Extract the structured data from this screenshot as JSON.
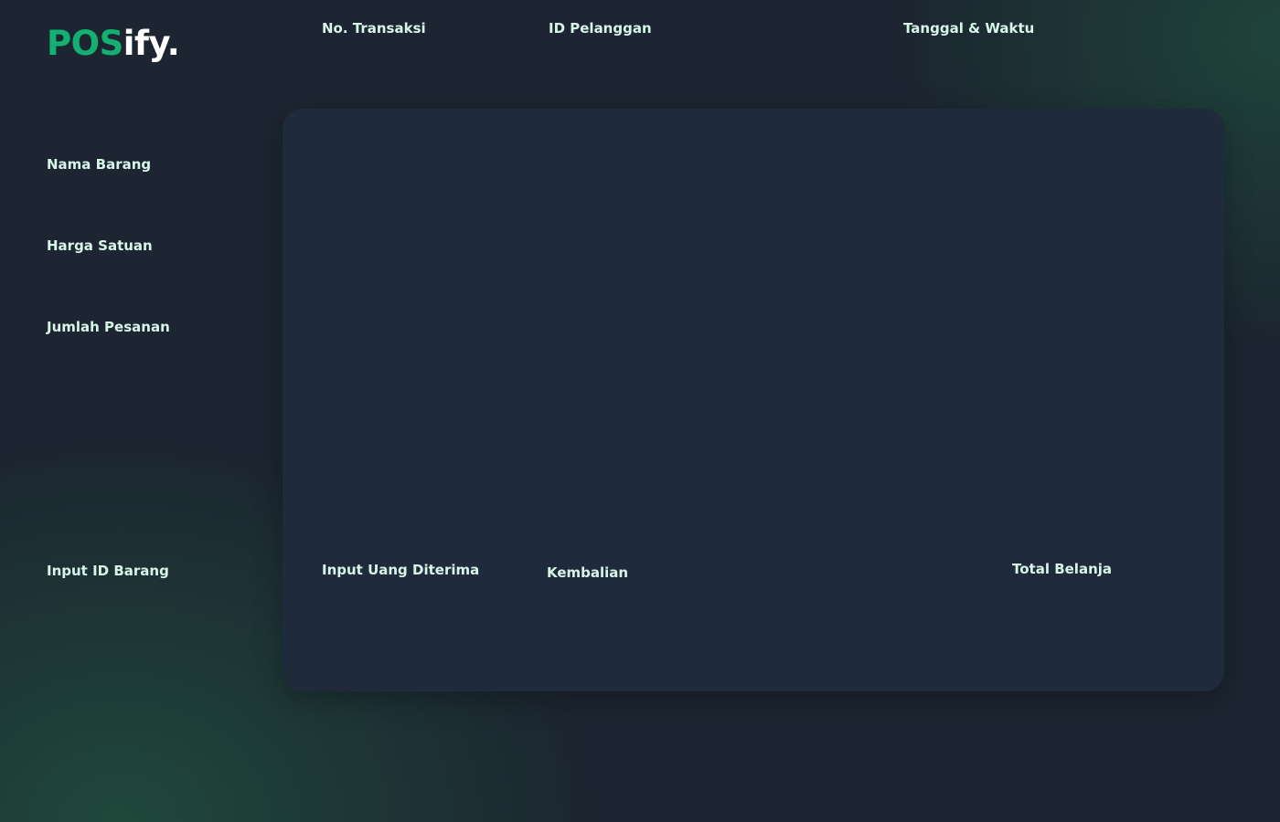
{
  "brand": {
    "logo_accent": "POS",
    "logo_rest": "ify.",
    "accent_color": "#13b071"
  },
  "header": {
    "transaction_number_label": "No. Transaksi",
    "customer_id_label": "ID Pelanggan",
    "datetime_label": "Tanggal & Waktu"
  },
  "sidebar": {
    "item_name_label": "Nama Barang",
    "unit_price_label": "Harga Satuan",
    "order_quantity_label": "Jumlah Pesanan",
    "input_item_id_label": "Input ID Barang"
  },
  "footer": {
    "cash_received_label": "Input Uang Diterima",
    "change_label": "Kembalian",
    "total_label": "Total Belanja"
  }
}
